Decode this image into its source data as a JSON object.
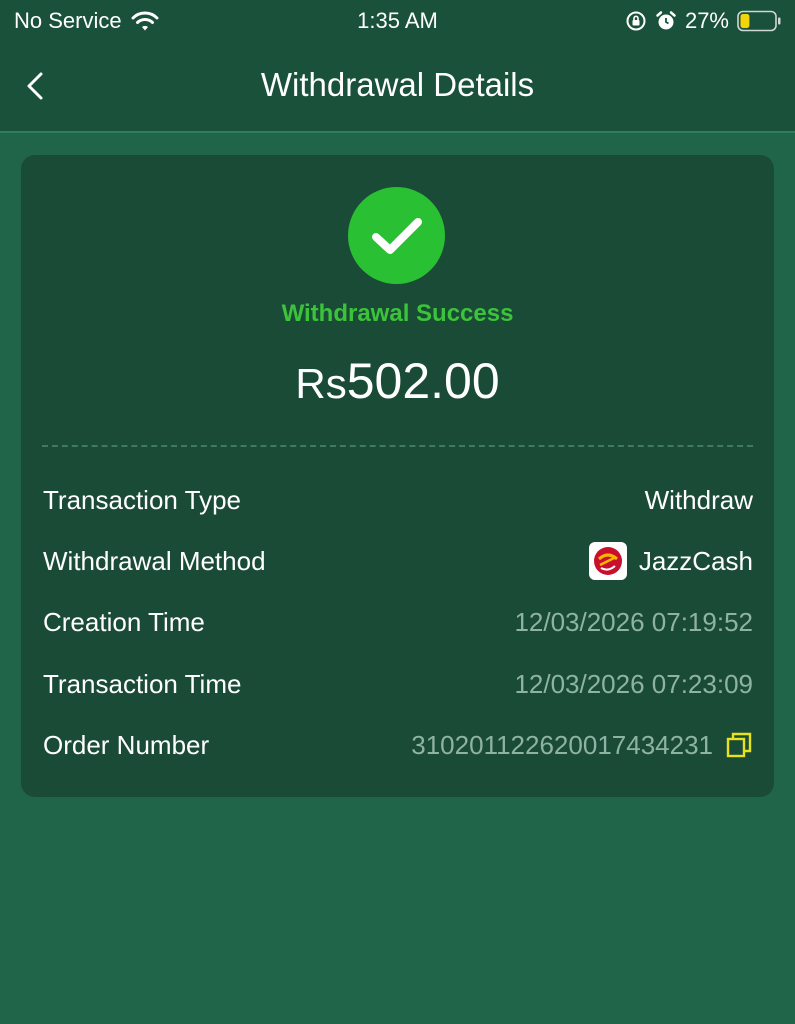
{
  "status_bar": {
    "carrier": "No Service",
    "time": "1:35 AM",
    "battery": "27%",
    "battery_level": 0.27,
    "icons": [
      "wifi-icon",
      "orientation-lock-icon",
      "alarm-icon",
      "battery-icon"
    ]
  },
  "header": {
    "title": "Withdrawal Details",
    "back_icon": "chevron-left-icon"
  },
  "result": {
    "status": "Withdrawal Success",
    "currency": "Rs",
    "amount": "502.00",
    "icon": "check-icon"
  },
  "details": [
    {
      "label": "Transaction Type",
      "value": "Withdraw"
    },
    {
      "label": "Withdrawal Method",
      "value": "JazzCash",
      "icon": "jazzcash-logo-icon"
    },
    {
      "label": "Creation Time",
      "value": "12/03/2026 07:19:52"
    },
    {
      "label": "Transaction Time",
      "value": "12/03/2026 07:23:09"
    },
    {
      "label": "Order Number",
      "value": "310201122620017434231",
      "icon": "copy-icon"
    }
  ],
  "colors": {
    "background": "#206449",
    "header": "#19513b",
    "card": "#1a4b37",
    "success": "#2ac033",
    "success_text": "#3bc43a",
    "muted_value": "#8fb3a3",
    "copy_icon": "#e6e21d",
    "battery": "#f2d50a"
  }
}
